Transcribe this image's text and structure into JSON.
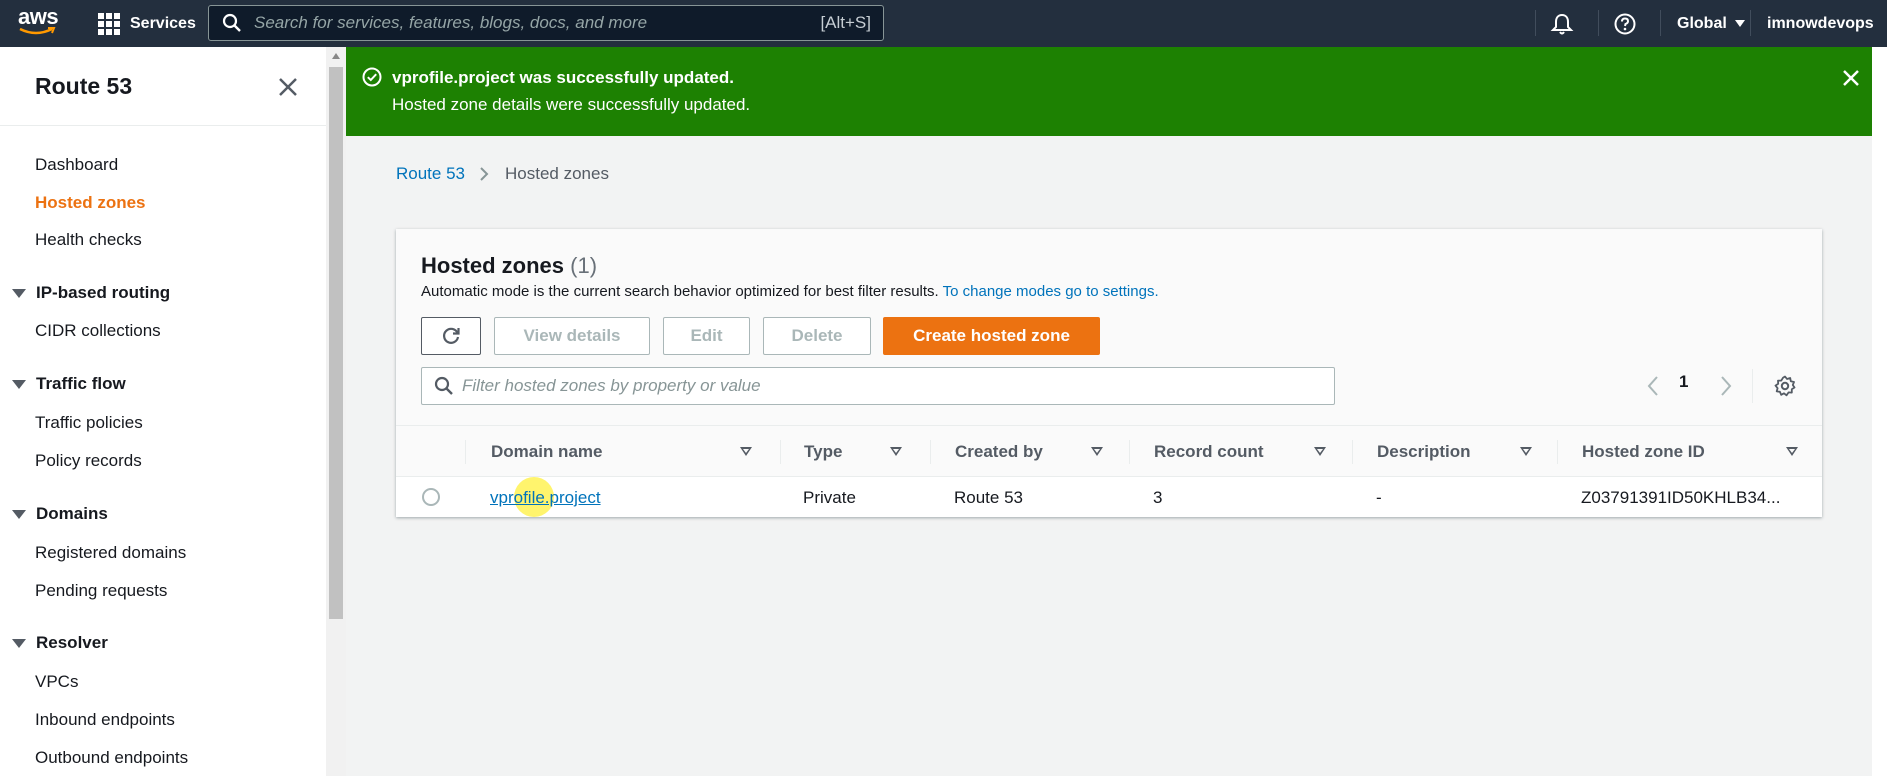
{
  "topnav": {
    "logo": "aws",
    "services_label": "Services",
    "search_placeholder": "Search for services, features, blogs, docs, and more",
    "search_shortcut": "[Alt+S]",
    "region": "Global",
    "account": "imnowdevops",
    "icons": [
      "services-grid-icon",
      "search-icon",
      "bell-icon",
      "help-icon",
      "caret-down-icon"
    ]
  },
  "sidebar": {
    "title": "Route 53",
    "items": [
      {
        "label": "Dashboard"
      },
      {
        "label": "Hosted zones",
        "active": true
      },
      {
        "label": "Health checks"
      }
    ],
    "sections": [
      {
        "title": "IP-based routing",
        "items": [
          "CIDR collections"
        ]
      },
      {
        "title": "Traffic flow",
        "items": [
          "Traffic policies",
          "Policy records"
        ]
      },
      {
        "title": "Domains",
        "items": [
          "Registered domains",
          "Pending requests"
        ]
      },
      {
        "title": "Resolver",
        "items": [
          "VPCs",
          "Inbound endpoints",
          "Outbound endpoints"
        ]
      }
    ]
  },
  "flash": {
    "title": "vprofile.project was successfully updated.",
    "message": "Hosted zone details were successfully updated.",
    "color": "#1d8102"
  },
  "breadcrumb": {
    "root": "Route 53",
    "current": "Hosted zones"
  },
  "panel": {
    "title": "Hosted zones",
    "count": "(1)",
    "description": "Automatic mode is the current search behavior optimized for best filter results.",
    "settings_link": "To change modes go to settings.",
    "buttons": {
      "view_details": "View details",
      "edit": "Edit",
      "delete": "Delete",
      "create": "Create hosted zone"
    },
    "filter_placeholder": "Filter hosted zones by property or value",
    "page": "1",
    "accent": "#ec7211"
  },
  "table": {
    "columns": [
      "Domain name",
      "Type",
      "Created by",
      "Record count",
      "Description",
      "Hosted zone ID"
    ],
    "rows": [
      {
        "domain": "vprofile.project",
        "type": "Private",
        "created_by": "Route 53",
        "record_count": "3",
        "description": "-",
        "zone_id": "Z03791391ID50KHLB34..."
      }
    ]
  }
}
